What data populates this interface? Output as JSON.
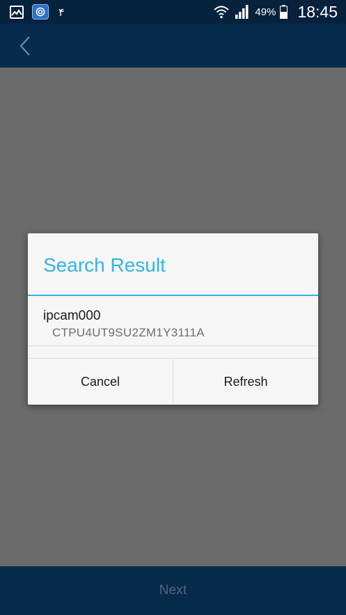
{
  "status_bar": {
    "notification_text": "۴",
    "battery_percent": "49%",
    "time": "18:45"
  },
  "header": {
    "back_icon": "chevron-left-icon"
  },
  "dialog": {
    "title": "Search Result",
    "results": [
      {
        "name": "ipcam000",
        "id": "CTPU4UT9SU2ZM1Y3111A"
      }
    ],
    "cancel_label": "Cancel",
    "refresh_label": "Refresh"
  },
  "footer": {
    "next_label": "Next"
  },
  "colors": {
    "accent": "#33b5e5",
    "header_bg": "#072b4d",
    "overlay": "#6b6b6b"
  }
}
